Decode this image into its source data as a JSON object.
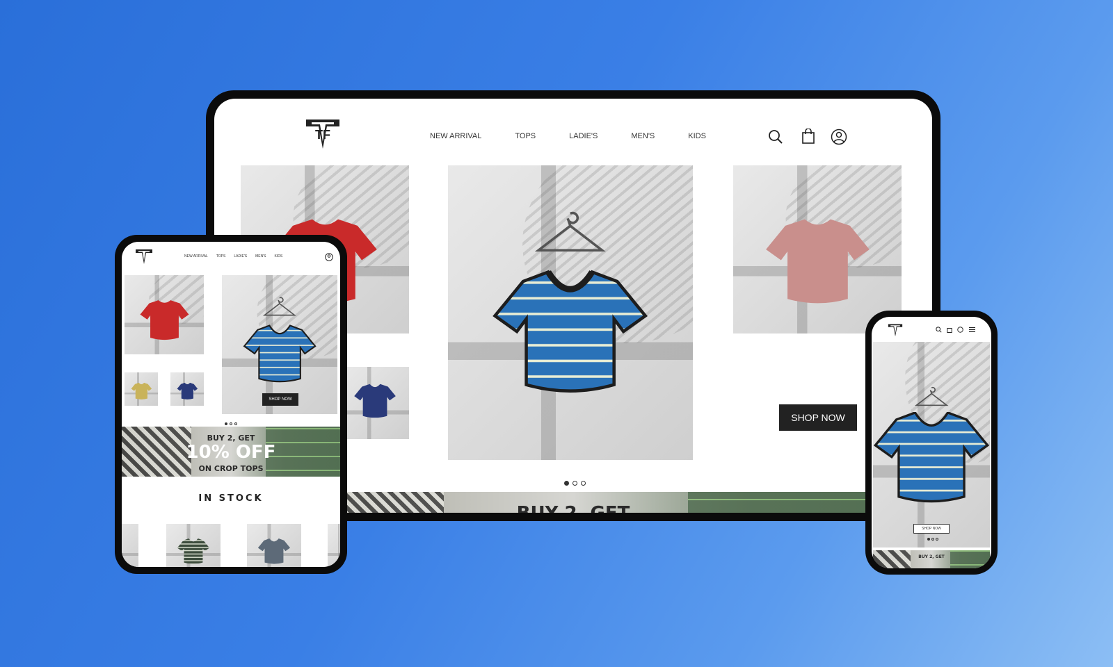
{
  "brand": {
    "logo_text": "TF"
  },
  "nav": {
    "items": [
      "NEW ARRIVAL",
      "TOPS",
      "LADIE'S",
      "MEN'S",
      "KIDS"
    ]
  },
  "icons": {
    "search": "search-icon",
    "bag": "shopping-bag-icon",
    "account": "account-icon",
    "menu": "hamburger-menu-icon"
  },
  "hero": {
    "cta_label": "SHOP NOW",
    "carousel_dots": 3,
    "active_dot": 0
  },
  "products": {
    "red_top": {
      "color": "#c92a2a"
    },
    "blue_striped_top": {
      "color": "#2a72b8"
    },
    "pink_top": {
      "color": "#c98f8c"
    },
    "yellow_top": {
      "color": "#c9b35a"
    },
    "navy_top": {
      "color": "#2a3a7a"
    }
  },
  "promo": {
    "line1": "BUY 2, GET",
    "line2": "10% OFF",
    "line3": "ON CROP TOPS"
  },
  "desktop_banner_text": "BUY 2, GET",
  "section": {
    "in_stock_title": "IN STOCK"
  }
}
